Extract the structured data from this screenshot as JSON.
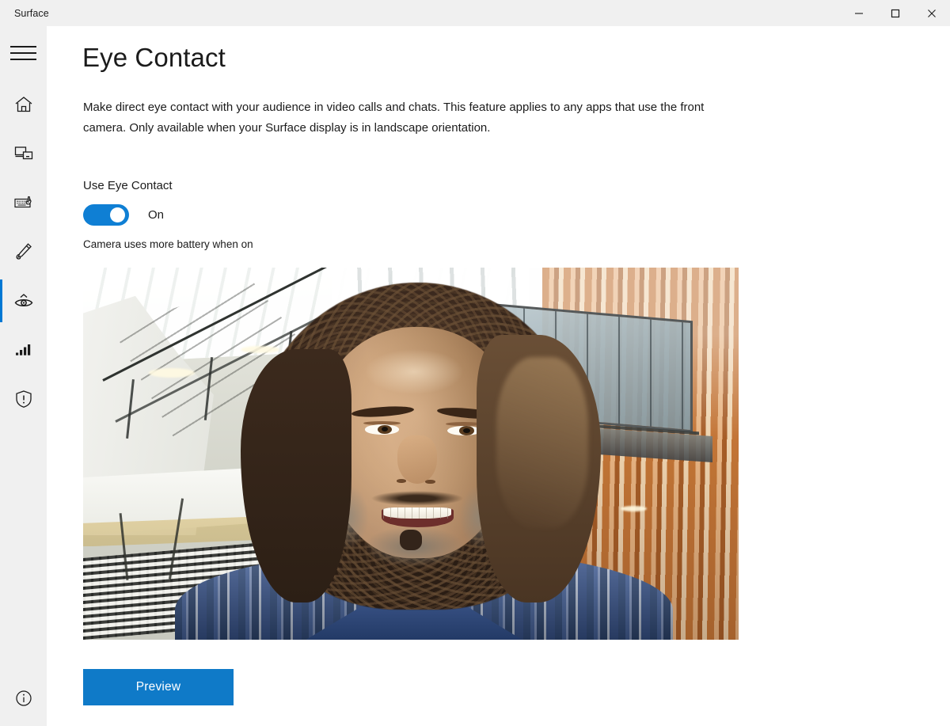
{
  "window": {
    "title": "Surface",
    "controls": [
      {
        "name": "minimize-button",
        "label": "Minimize",
        "glyph": "minimize-icon"
      },
      {
        "name": "maximize-button",
        "label": "Maximize",
        "glyph": "maximize-icon"
      },
      {
        "name": "close-button",
        "label": "Close",
        "glyph": "close-icon"
      }
    ]
  },
  "sidebar": {
    "menu_label": "Navigation menu",
    "items": [
      {
        "id": "home",
        "icon": "home-icon",
        "label": "Home",
        "selected": false
      },
      {
        "id": "devices",
        "icon": "devices-icon",
        "label": "Devices",
        "selected": false
      },
      {
        "id": "keyboard",
        "icon": "keyboard-icon",
        "label": "Keyboard",
        "selected": false
      },
      {
        "id": "pen",
        "icon": "pen-icon",
        "label": "Pen",
        "selected": false
      },
      {
        "id": "eye",
        "icon": "eye-icon",
        "label": "Eye Contact",
        "selected": true
      },
      {
        "id": "signal",
        "icon": "signal-bars-icon",
        "label": "Signal",
        "selected": false
      },
      {
        "id": "shield",
        "icon": "shield-icon",
        "label": "Warranty and services",
        "selected": false
      }
    ],
    "bottom_item": {
      "id": "about",
      "icon": "info-icon",
      "label": "About"
    }
  },
  "main": {
    "title": "Eye Contact",
    "description": "Make direct eye contact with your audience in video calls and chats. This feature applies to any apps that use the front camera. Only available when your Surface display is in landscape orientation.",
    "setting_label": "Use Eye Contact",
    "toggle": {
      "state_label": "On",
      "checked": true,
      "accent_color": "#0f7fd4"
    },
    "hint": "Camera uses more battery when on",
    "camera_preview": {
      "name": "camera-preview",
      "alt": "Front camera preview showing a smiling man with long curly hair in a building atrium with a staircase, skylight and wooden louvre wall"
    },
    "preview_button": {
      "label": "Preview",
      "color": "#0f7ac8"
    }
  },
  "colors": {
    "titlebar_bg": "#f0f0f0",
    "sidebar_bg": "#f0f0f0",
    "content_bg": "#ffffff",
    "text": "#1b1b1b",
    "accent": "#0078d4"
  }
}
